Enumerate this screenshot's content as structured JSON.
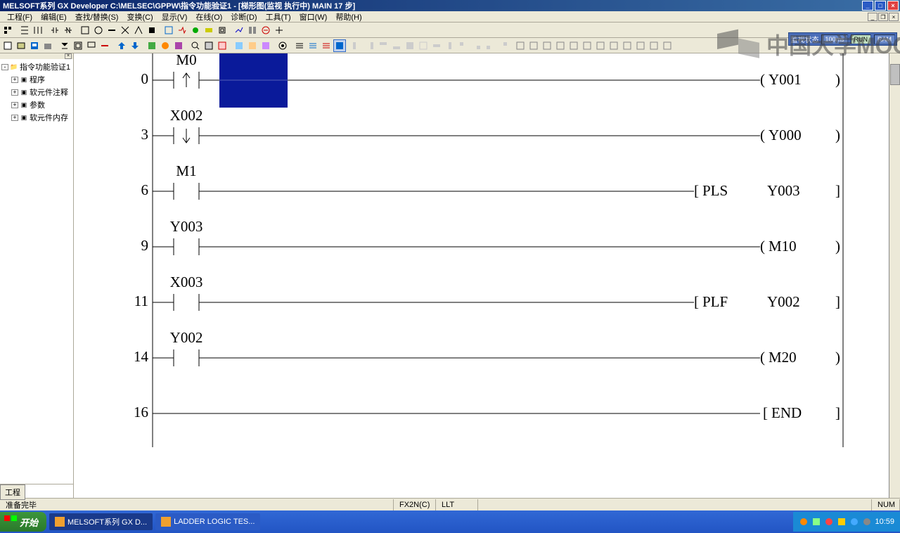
{
  "title": "MELSOFT系列 GX Developer C:\\MELSEC\\GPPW\\指令功能验证1 - [梯形图(监视 执行中)     MAIN     17 步]",
  "menu": [
    "工程(F)",
    "编辑(E)",
    "查找/替换(S)",
    "变换(C)",
    "显示(V)",
    "在线(O)",
    "诊断(D)",
    "工具(T)",
    "窗口(W)",
    "帮助(H)"
  ],
  "tree": {
    "root": "指令功能验证1",
    "items": [
      "程序",
      "软元件注释",
      "参数",
      "软元件内存"
    ]
  },
  "sidebar_tab": "工程",
  "ladder": {
    "rungs": [
      {
        "step": "0",
        "contact": "M0",
        "contact_type": "rising",
        "output_type": "coil",
        "output": "Y001",
        "highlight": true
      },
      {
        "step": "3",
        "contact": "X002",
        "contact_type": "falling",
        "output_type": "coil",
        "output": "Y000"
      },
      {
        "step": "6",
        "contact": "M1",
        "contact_type": "no",
        "output_type": "func",
        "func": "PLS",
        "func_arg": "Y003"
      },
      {
        "step": "9",
        "contact": "Y003",
        "contact_type": "no",
        "output_type": "coil",
        "output": "M10"
      },
      {
        "step": "11",
        "contact": "X003",
        "contact_type": "no",
        "output_type": "func",
        "func": "PLF",
        "func_arg": "Y002"
      },
      {
        "step": "14",
        "contact": "Y002",
        "contact_type": "no",
        "output_type": "coil",
        "output": "M20"
      },
      {
        "step": "16",
        "contact": "",
        "contact_type": "",
        "output_type": "end",
        "output": "END"
      }
    ]
  },
  "monitor_label": "监视状态",
  "monitor_ms": "100ms",
  "monitor_run": "RUN",
  "monitor_ram": "RAM",
  "status_left": "准备完毕",
  "status_cpu": "FX2N(C)",
  "status_mode": "LLT",
  "status_num": "NUM",
  "start_label": "开始",
  "tasks": [
    {
      "label": "MELSOFT系列 GX D...",
      "active": true
    },
    {
      "label": "LADDER LOGIC TES...",
      "active": false
    }
  ],
  "clock": "10:59",
  "watermark_text": "中国大学MOC"
}
